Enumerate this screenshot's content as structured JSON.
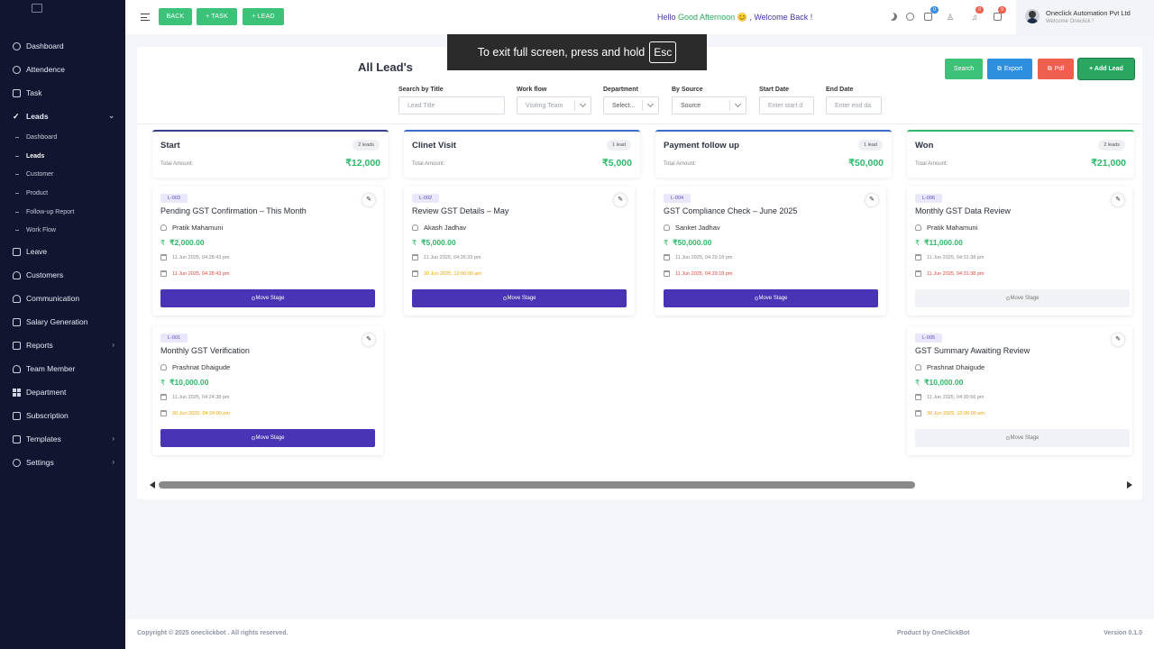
{
  "sidebar": {
    "items": [
      {
        "label": "Dashboard",
        "icon": "dashboard-icon"
      },
      {
        "label": "Attendence",
        "icon": "attendance-icon"
      },
      {
        "label": "Task",
        "icon": "task-icon"
      },
      {
        "label": "Leads",
        "icon": "check-icon",
        "active": true,
        "expanded": true,
        "children": [
          "Dashboard",
          "Leads",
          "Customer",
          "Product",
          "Follow-up Report",
          "Work Flow"
        ],
        "active_child": "Leads"
      },
      {
        "label": "Leave",
        "icon": "leave-icon"
      },
      {
        "label": "Customers",
        "icon": "customers-icon"
      },
      {
        "label": "Communication",
        "icon": "communication-icon"
      },
      {
        "label": "Salary Generation",
        "icon": "salary-icon"
      },
      {
        "label": "Reports",
        "icon": "reports-icon",
        "has_children": true
      },
      {
        "label": "Team Member",
        "icon": "team-member-icon"
      },
      {
        "label": "Department",
        "icon": "department-icon"
      },
      {
        "label": "Subscription",
        "icon": "subscription-icon"
      },
      {
        "label": "Templates",
        "icon": "templates-icon",
        "has_children": true
      },
      {
        "label": "Settings",
        "icon": "settings-icon",
        "has_children": true
      }
    ]
  },
  "topbar": {
    "back": "BACK",
    "task": "+ TASK",
    "lead": "+ LEAD",
    "greet_hello": "Hello",
    "greet_time": "Good Afternoon",
    "greet_emoji": "😊",
    "greet_rest": ", Welcome Back !",
    "badges": {
      "tasks": "0",
      "notifications": "0",
      "messages": "0"
    },
    "company": "Oneclick Automation Pvt Ltd",
    "welcome": "Welcome Oneclick !"
  },
  "overlay": {
    "text": "To exit full screen, press and hold",
    "key": "Esc"
  },
  "page": {
    "title": "All Lead's",
    "search": "Search",
    "export": "Export",
    "pdf": "Pdf",
    "add_lead": "+ Add Lead"
  },
  "filters": {
    "title": {
      "label": "Search by Title",
      "placeholder": "Lead Title"
    },
    "workflow": {
      "label": "Work flow",
      "value": "Visiting Team"
    },
    "department": {
      "label": "Department",
      "value": "Select..."
    },
    "source": {
      "label": "By Source",
      "value": "Source"
    },
    "start": {
      "label": "Start Date",
      "placeholder": "Enter start d"
    },
    "end": {
      "label": "End Date",
      "placeholder": "Enter end da"
    }
  },
  "total_amount_label": "Total Amount:",
  "move_stage_label": "Move Stage",
  "columns": [
    {
      "name": "Start",
      "count": "2 leads",
      "amount": "₹12,000",
      "cards": [
        {
          "id": "L-003",
          "title": "Pending GST Confirmation – This Month",
          "person": "Pratik Mahamuni",
          "value": "₹2,000.00",
          "created": "11 Jun 2025, 04:28:43 pm",
          "due": "11 Jun 2025, 04:28:43 pm",
          "due_color": "red",
          "stage_enabled": true
        },
        {
          "id": "L-001",
          "title": "Monthly GST Verification",
          "person": "Prashnat Dhaigude",
          "value": "₹10,000.00",
          "created": "11 Jun 2025, 04:24:38 pm",
          "due": "30 Jun 2025, 04:24:00 pm",
          "due_color": "orange",
          "stage_enabled": true
        }
      ]
    },
    {
      "name": "Clinet Visit",
      "count": "1 lead",
      "amount": "₹5,000",
      "cards": [
        {
          "id": "L-002",
          "title": "Review GST Details – May",
          "person": "Akash Jadhav",
          "value": "₹5,000.00",
          "created": "11 Jun 2025, 04:26:33 pm",
          "due": "30 Jun 2025, 12:00:00 am",
          "due_color": "orange",
          "stage_enabled": true
        }
      ]
    },
    {
      "name": "Payment follow up",
      "count": "1 lead",
      "amount": "₹50,000",
      "cards": [
        {
          "id": "L-004",
          "title": "GST Compliance Check – June 2025",
          "person": "Sanket Jadhav",
          "value": "₹50,000.00",
          "created": "11 Jun 2025, 04:29:18 pm",
          "due": "11 Jun 2025, 04:29:18 pm",
          "due_color": "red",
          "stage_enabled": true
        }
      ]
    },
    {
      "name": "Won",
      "count": "2 leads",
      "amount": "₹21,000",
      "cards": [
        {
          "id": "L-006",
          "title": "Monthly GST Data Review",
          "person": "Pratik Mahamuni",
          "value": "₹11,000.00",
          "created": "11 Jun 2025, 04:31:38 pm",
          "due": "11 Jun 2025, 04:31:38 pm",
          "due_color": "red",
          "stage_enabled": false
        },
        {
          "id": "L-005",
          "title": "GST Summary Awaiting Review",
          "person": "Prashnat Dhaigude",
          "value": "₹10,000.00",
          "created": "11 Jun 2025, 04:30:56 pm",
          "due": "30 Jun 2025, 12:00:00 am",
          "due_color": "orange",
          "stage_enabled": false
        }
      ]
    }
  ],
  "colors": {
    "sidebar_bg": "#111530",
    "accent_green": "#3cc279",
    "primary_purple": "#4834b5",
    "export_blue": "#2d8fdd",
    "pdf_red": "#ef5f4d"
  },
  "footer": {
    "copyright": "Copyright © 2025 oneclickbot . All rights reserved.",
    "product": "Product by OneClickBot",
    "version": "Version 0.1.0"
  }
}
